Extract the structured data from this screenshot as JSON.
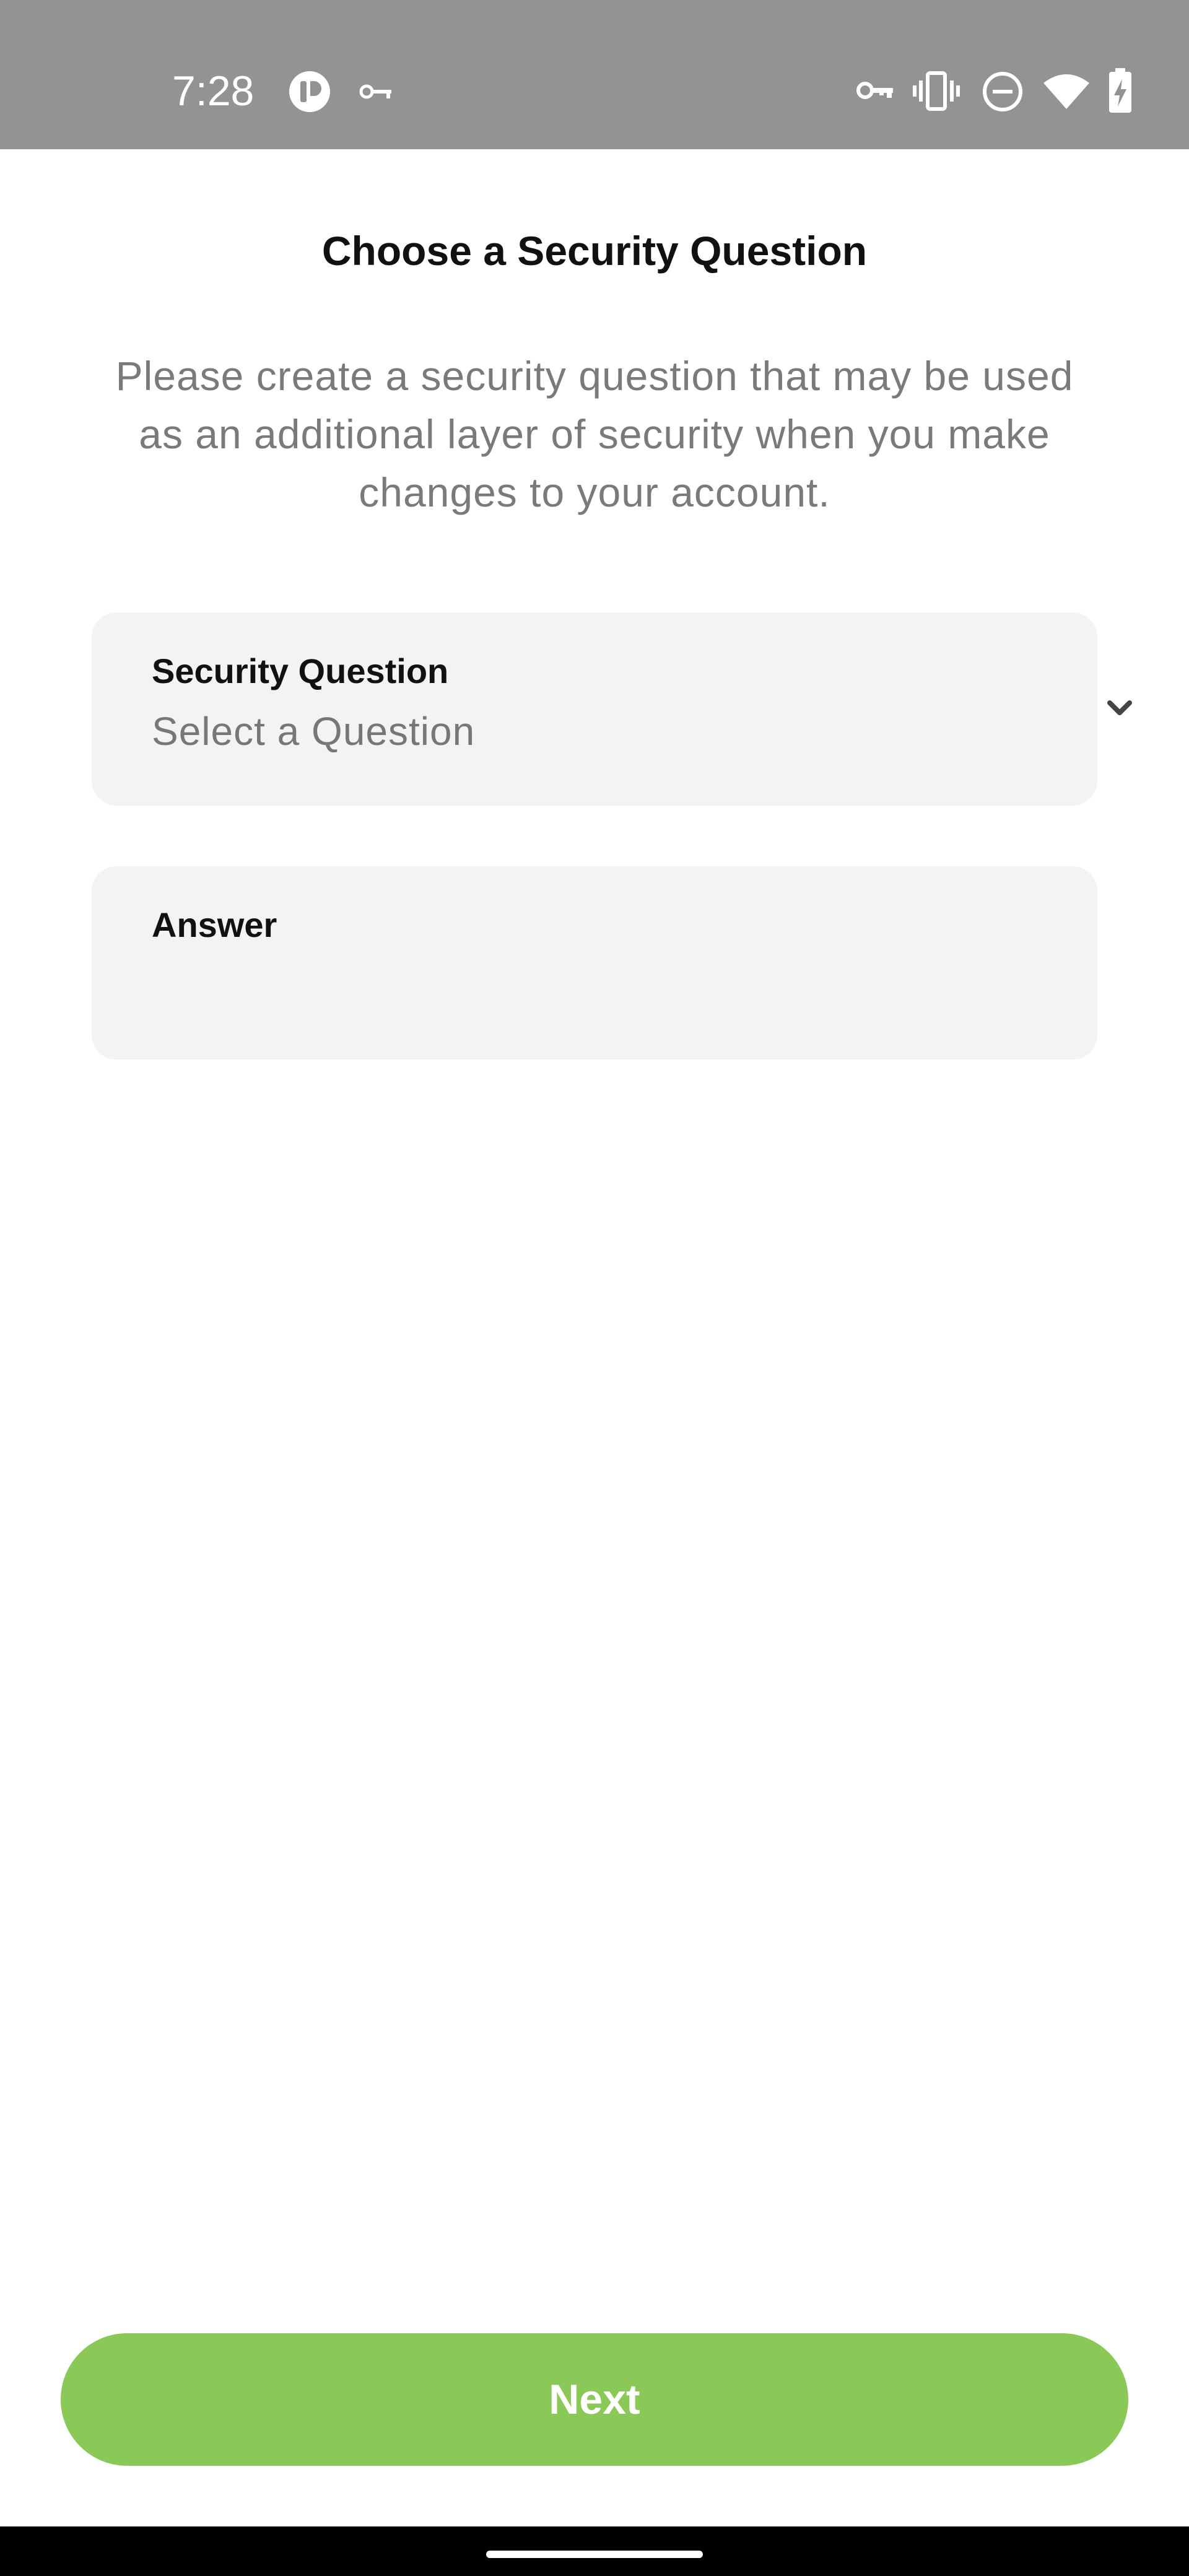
{
  "status_bar": {
    "time": "7:28",
    "icons_left": [
      "app-notification-icon",
      "vpn-key-icon"
    ],
    "icons_right": [
      "vpn-key-icon",
      "vibrate-icon",
      "do-not-disturb-icon",
      "wifi-icon",
      "battery-charging-icon"
    ],
    "background": "#939393"
  },
  "page": {
    "title": "Choose a Security Question",
    "description": "Please create a security question that may be used as an additional layer of security when you make changes to your account."
  },
  "security_question": {
    "label": "Security Question",
    "placeholder": "Select a Question",
    "icon": "chevron-down-icon"
  },
  "answer": {
    "label": "Answer",
    "value": ""
  },
  "actions": {
    "next_label": "Next",
    "next_color": "#8ac858"
  }
}
